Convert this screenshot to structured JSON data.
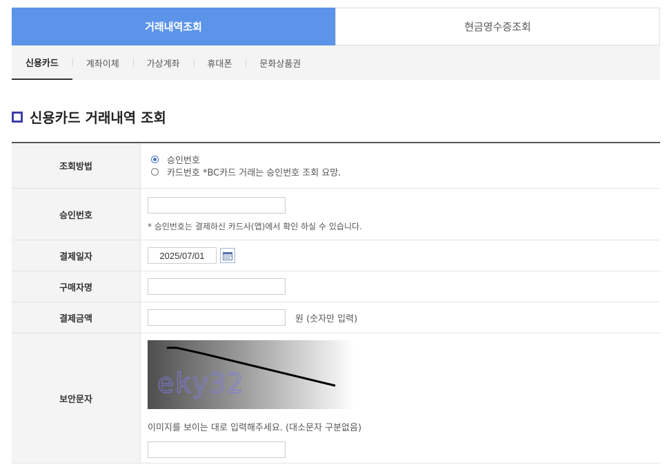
{
  "top_tabs": [
    {
      "label": "거래내역조회"
    },
    {
      "label": "현금영수증조회"
    }
  ],
  "sub_tabs": [
    {
      "label": "신용카드"
    },
    {
      "label": "계좌이체"
    },
    {
      "label": "가상계좌"
    },
    {
      "label": "휴대폰"
    },
    {
      "label": "문화상품권"
    }
  ],
  "section_title": "신용카드 거래내역 조회",
  "form": {
    "method": {
      "label": "조회방법",
      "options": [
        "승인번호",
        "카드번호 *BC카드 거래는 승인번호 조회 요망."
      ],
      "selected": "승인번호"
    },
    "approval": {
      "label": "승인번호",
      "value": "",
      "note": "* 승인번호는 결제하신 카드사(앱)에서 확인 하실 수 있습니다."
    },
    "pay_date": {
      "label": "결제일자",
      "value": "2025/07/01",
      "icon": "calendar-icon"
    },
    "buyer": {
      "label": "구매자명",
      "value": ""
    },
    "amount": {
      "label": "결제금액",
      "value": "",
      "unit": "원 (숫자만 입력)"
    },
    "security": {
      "label": "보안문자",
      "captcha_text": "eky32",
      "note": "이미지를 보이는 대로 입력해주세요. (대소문자 구분없음)",
      "value": ""
    }
  },
  "colors": {
    "active_tab": "#5b94e8",
    "title_icon": "#3d3fa6",
    "radio": "#4a76c8"
  }
}
